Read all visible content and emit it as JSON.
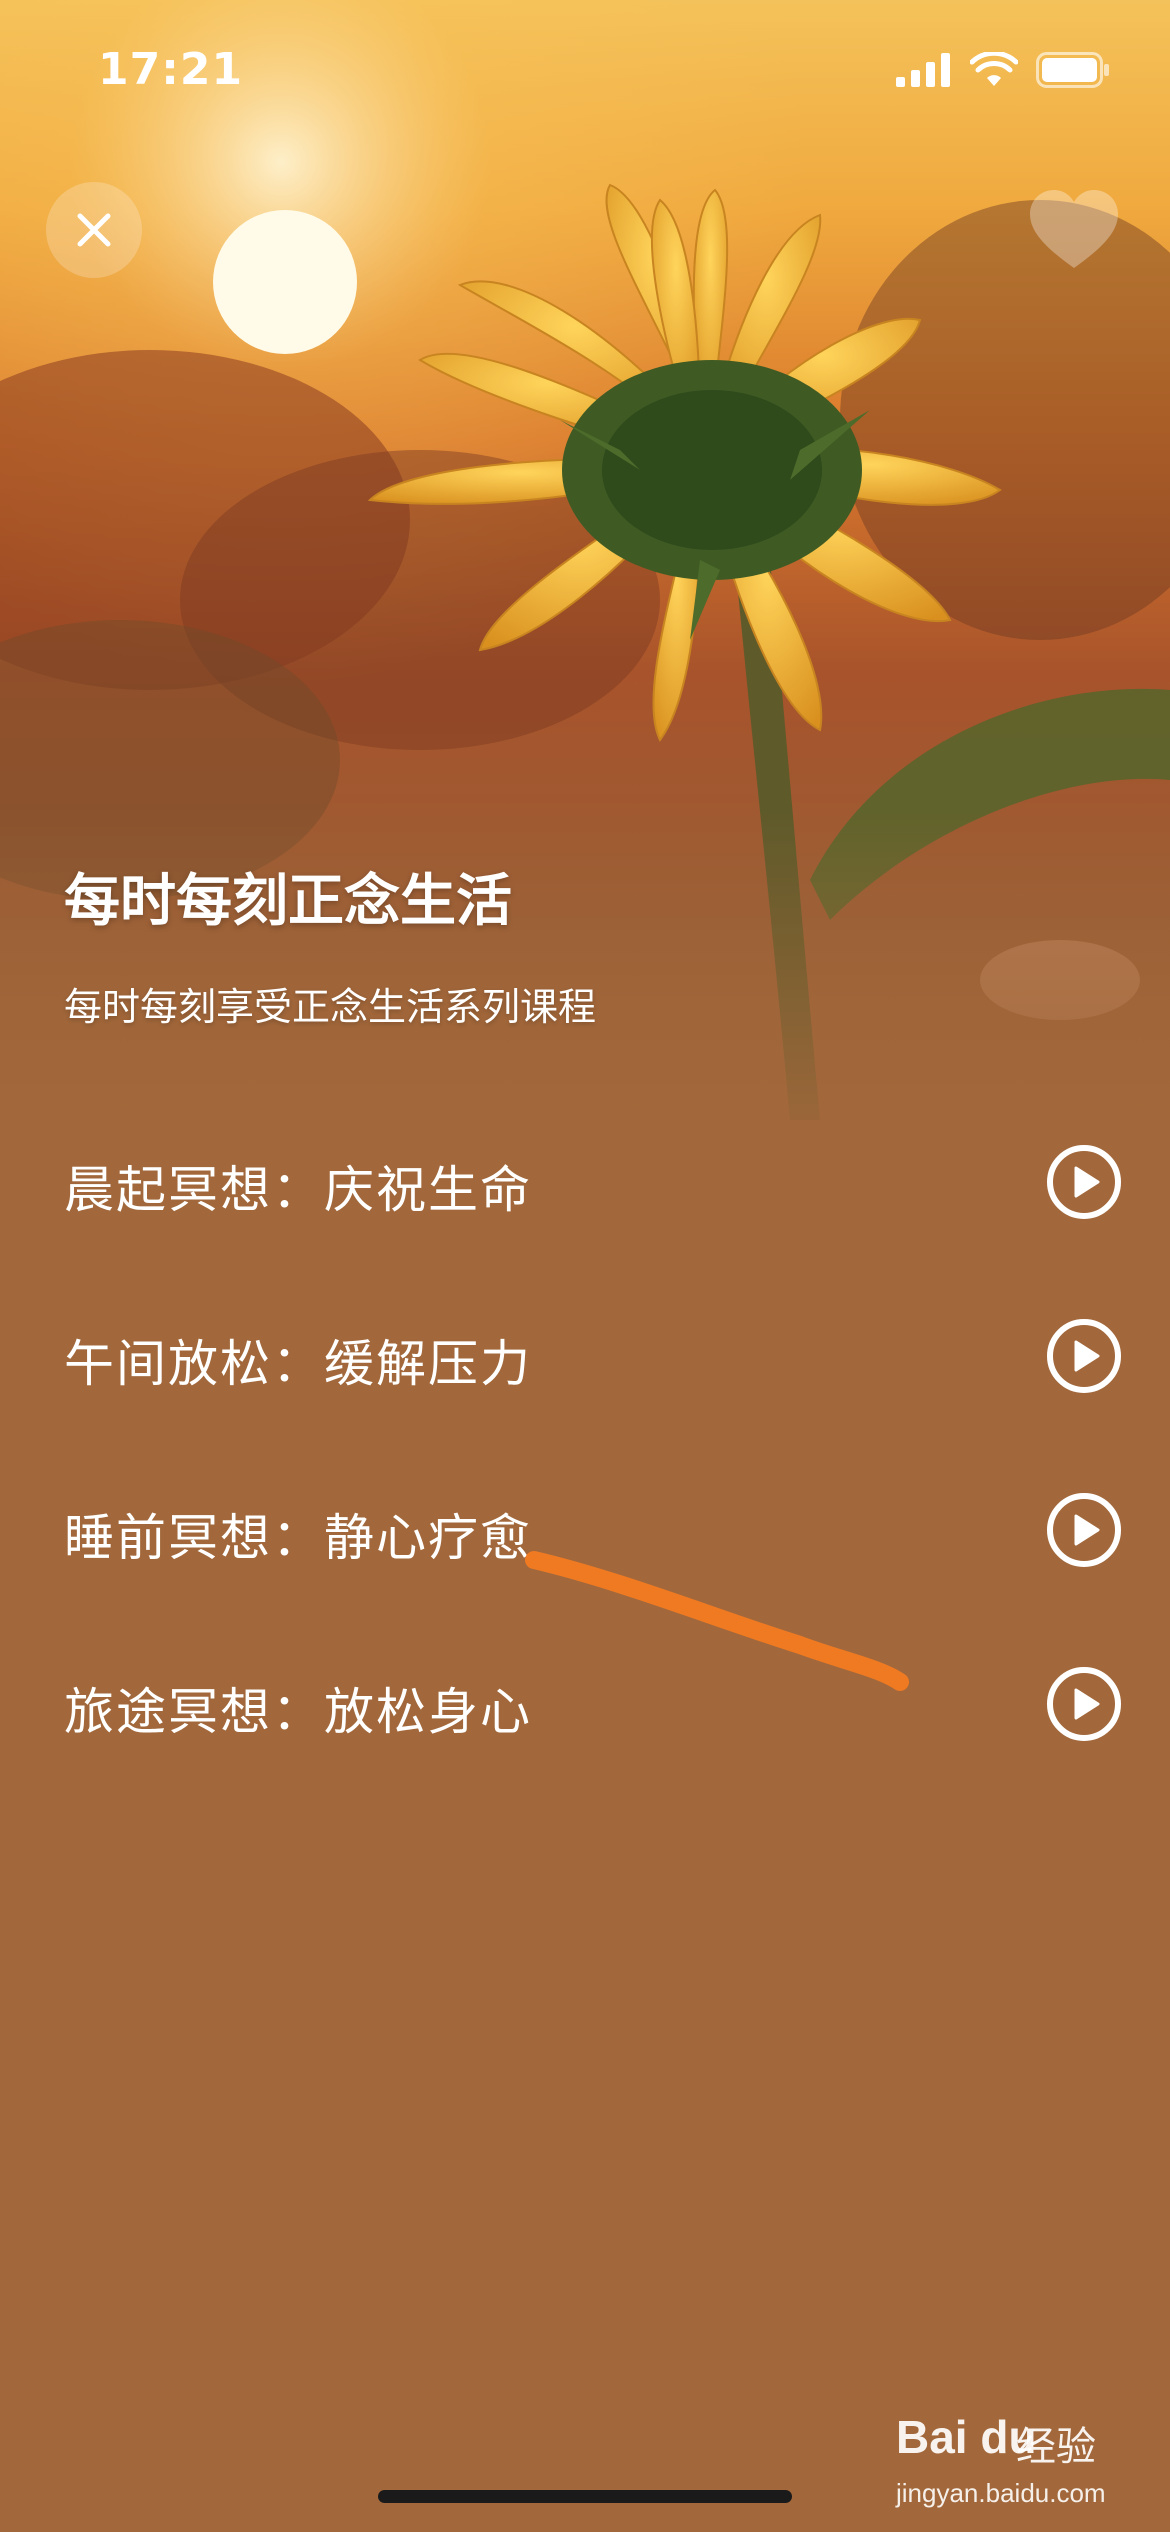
{
  "status_bar": {
    "time": "17:21"
  },
  "hero": {
    "image": "sunflower-at-sunset"
  },
  "header": {
    "close_icon": "close-icon",
    "favorite_icon": "heart-icon"
  },
  "course": {
    "title": "每时每刻正念生活",
    "subtitle": "每时每刻享受正念生活系列课程"
  },
  "tracks": [
    {
      "label": "晨起冥想：庆祝生命",
      "icon": "play-icon"
    },
    {
      "label": "午间放松：缓解压力",
      "icon": "play-icon"
    },
    {
      "label": "睡前冥想：静心疗愈",
      "icon": "play-icon"
    },
    {
      "label": "旅途冥想：放松身心",
      "icon": "play-icon"
    }
  ],
  "watermark": {
    "logo": "Bai du",
    "label": "经验",
    "url": "jingyan.baidu.com"
  },
  "colors": {
    "background": "#a2683b",
    "annotation_stroke": "#f07a22",
    "text": "#ffffff"
  }
}
